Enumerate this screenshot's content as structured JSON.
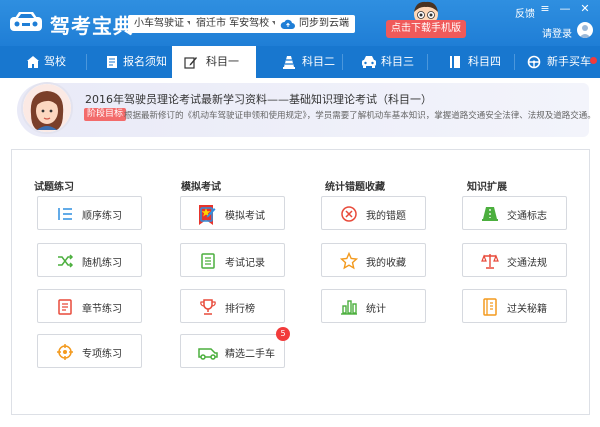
{
  "app": {
    "title": "驾考宝典",
    "brand_color": "#1f7ed6"
  },
  "titlebar": {
    "vehicle_select": "小车驾驶证",
    "school_select": "宿迁市 军安驾校",
    "sync_label": "同步到云端",
    "download_label": "点击下载手机版",
    "feedback_label": "反馈",
    "login_label": "请登录",
    "menu_glyph": "≡",
    "minimize_glyph": "—",
    "close_glyph": "✕"
  },
  "nav": {
    "items": [
      {
        "label": "驾校",
        "icon": "school-icon"
      },
      {
        "label": "报名须知",
        "icon": "notice-icon"
      },
      {
        "label": "科目一",
        "icon": "edit-icon",
        "active": true
      },
      {
        "label": "科目二",
        "icon": "cone-icon"
      },
      {
        "label": "科目三",
        "icon": "car-icon"
      },
      {
        "label": "科目四",
        "icon": "book-icon"
      },
      {
        "label": "新手买车",
        "icon": "steering-wheel-icon"
      }
    ]
  },
  "banner": {
    "title": "2016年驾驶员理论考试最新学习资料——基础知识理论考试（科目一）",
    "badge": "阶段目标",
    "desc": "根据最新修订的《机动车驾驶证申领和使用规定》，学员需要了解机动车基本知识，掌握道路交通安全法律、法规及道路交通。"
  },
  "sections": [
    {
      "title": "试题练习",
      "items": [
        {
          "label": "顺序练习",
          "icon": "list-icon"
        },
        {
          "label": "随机练习",
          "icon": "shuffle-icon"
        },
        {
          "label": "章节练习",
          "icon": "chapter-icon"
        },
        {
          "label": "专项练习",
          "icon": "target-icon"
        }
      ]
    },
    {
      "title": "模拟考试",
      "items": [
        {
          "label": "模拟考试",
          "icon": "exam-edit-icon"
        },
        {
          "label": "考试记录",
          "icon": "record-icon"
        },
        {
          "label": "排行榜",
          "icon": "trophy-icon"
        },
        {
          "label": "精选二手车",
          "icon": "used-car-icon",
          "badge": "5"
        }
      ]
    },
    {
      "title": "统计错题收藏",
      "items": [
        {
          "label": "我的错题",
          "icon": "wrong-icon"
        },
        {
          "label": "我的收藏",
          "icon": "star-icon"
        },
        {
          "label": "统计",
          "icon": "bar-chart-icon"
        }
      ]
    },
    {
      "title": "知识扩展",
      "items": [
        {
          "label": "交通标志",
          "icon": "road-sign-icon"
        },
        {
          "label": "交通法规",
          "icon": "scales-icon"
        },
        {
          "label": "过关秘籍",
          "icon": "secret-book-icon"
        }
      ]
    }
  ]
}
